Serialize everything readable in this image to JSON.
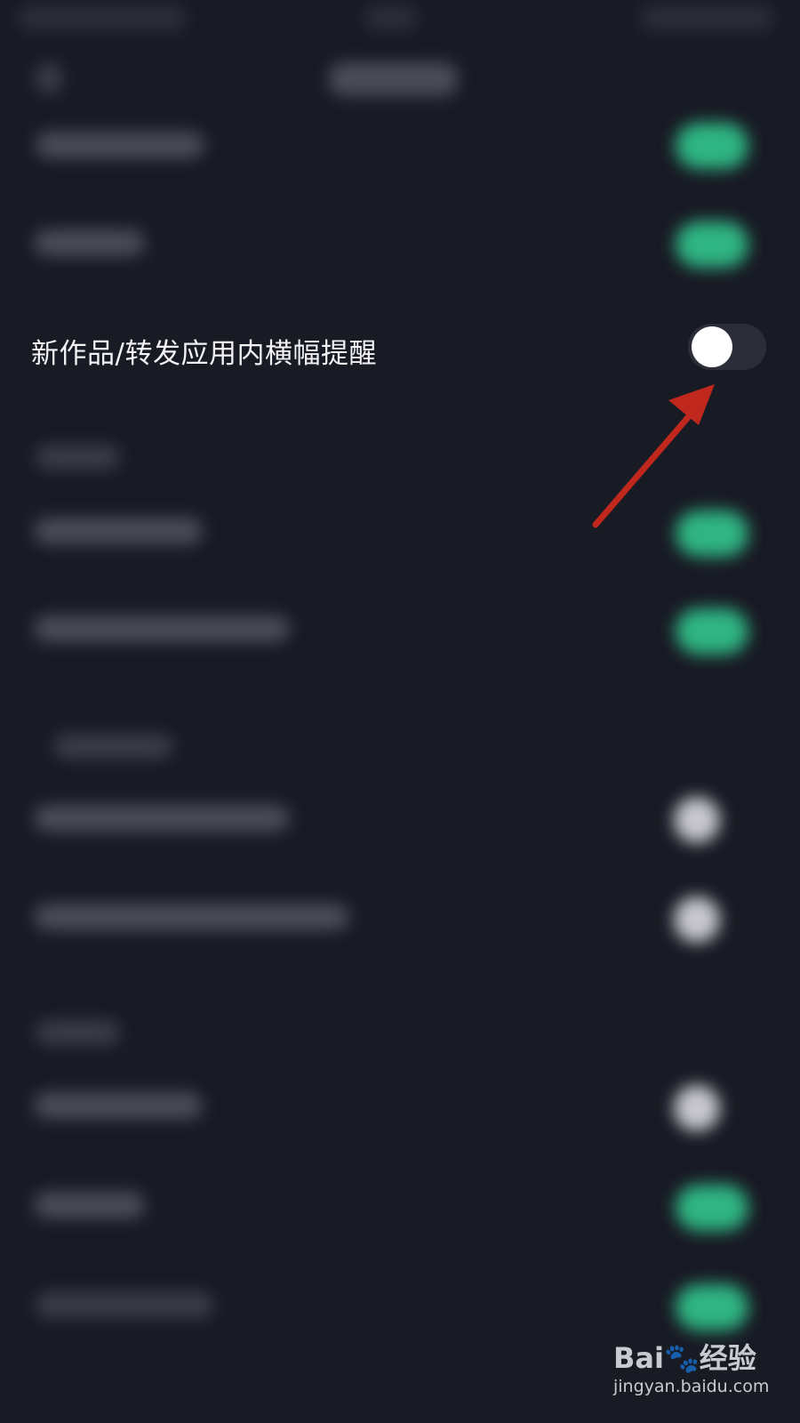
{
  "focused_setting": {
    "label": "新作品/转发应用内横幅提醒",
    "switch_state": "off"
  },
  "other_settings": {
    "switch_states": [
      "on",
      "on",
      "on",
      "on",
      "off",
      "off",
      "off",
      "on",
      "on"
    ]
  },
  "annotation": {
    "arrow_color": "#c0281e"
  },
  "watermark": {
    "brand": "Bai🐾经验",
    "url": "jingyan.baidu.com"
  },
  "colors": {
    "background": "#181a24",
    "switch_on": "#2fb583",
    "switch_off_track": "#2b2d38",
    "label_text": "#f2f2f4"
  }
}
